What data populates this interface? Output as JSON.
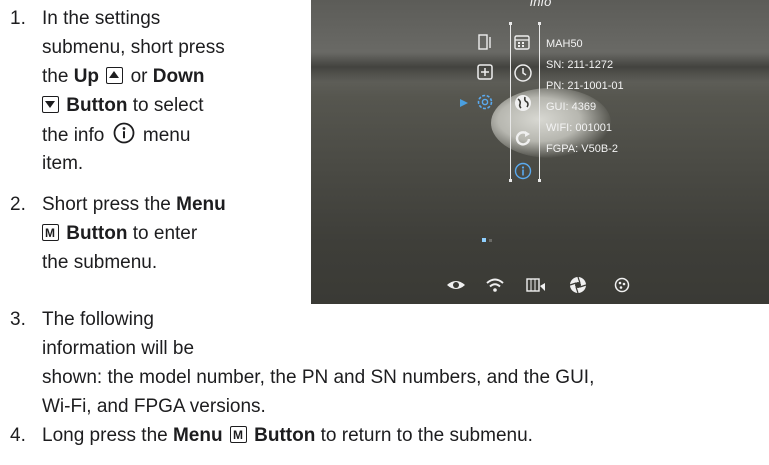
{
  "steps": [
    {
      "num": "1.",
      "lines": [
        "In the settings",
        "submenu, short press",
        "the ",
        "or ",
        "Button to select",
        "the info ",
        "menu",
        "item."
      ],
      "up": "Up",
      "down": "Down",
      "button": "Button",
      "info_text": "the info",
      "menu_word": "menu"
    },
    {
      "num": "2.",
      "short": "Short press the ",
      "menu": "Menu",
      "button": "Button",
      "rest": " to enter",
      "last": "the submenu."
    },
    {
      "num": "3.",
      "line1": "The following",
      "line2": "information will be",
      "line3": "shown: the model number, the PN and SN numbers, and the GUI,",
      "line4": "Wi-Fi, and FPGA versions."
    },
    {
      "num": "4.",
      "pre": "Long press the ",
      "menu": "Menu",
      "button": "Button",
      "post": " to return to the submenu."
    }
  ],
  "screen": {
    "title": "Info",
    "info": [
      "MAH50",
      "SN: 211-1272",
      "PN: 21-1001-01",
      "GUI: 4369",
      "WIFI: 001001",
      "FGPA: V50B-2"
    ]
  },
  "icons": {
    "left_column": [
      "brightness-icon",
      "zoom-box-icon",
      "settings-gear-icon"
    ],
    "middle_column": [
      "calendar-icon",
      "clock-icon",
      "globe-icon",
      "reset-icon",
      "info-icon"
    ],
    "bottom_bar": [
      "eye-icon",
      "wifi-icon",
      "video-recording-icon",
      "shutter-icon",
      "palette-icon"
    ]
  },
  "colors": {
    "selection_arrow": "#4a9fe0",
    "info_highlight": "#5aaaf0"
  }
}
